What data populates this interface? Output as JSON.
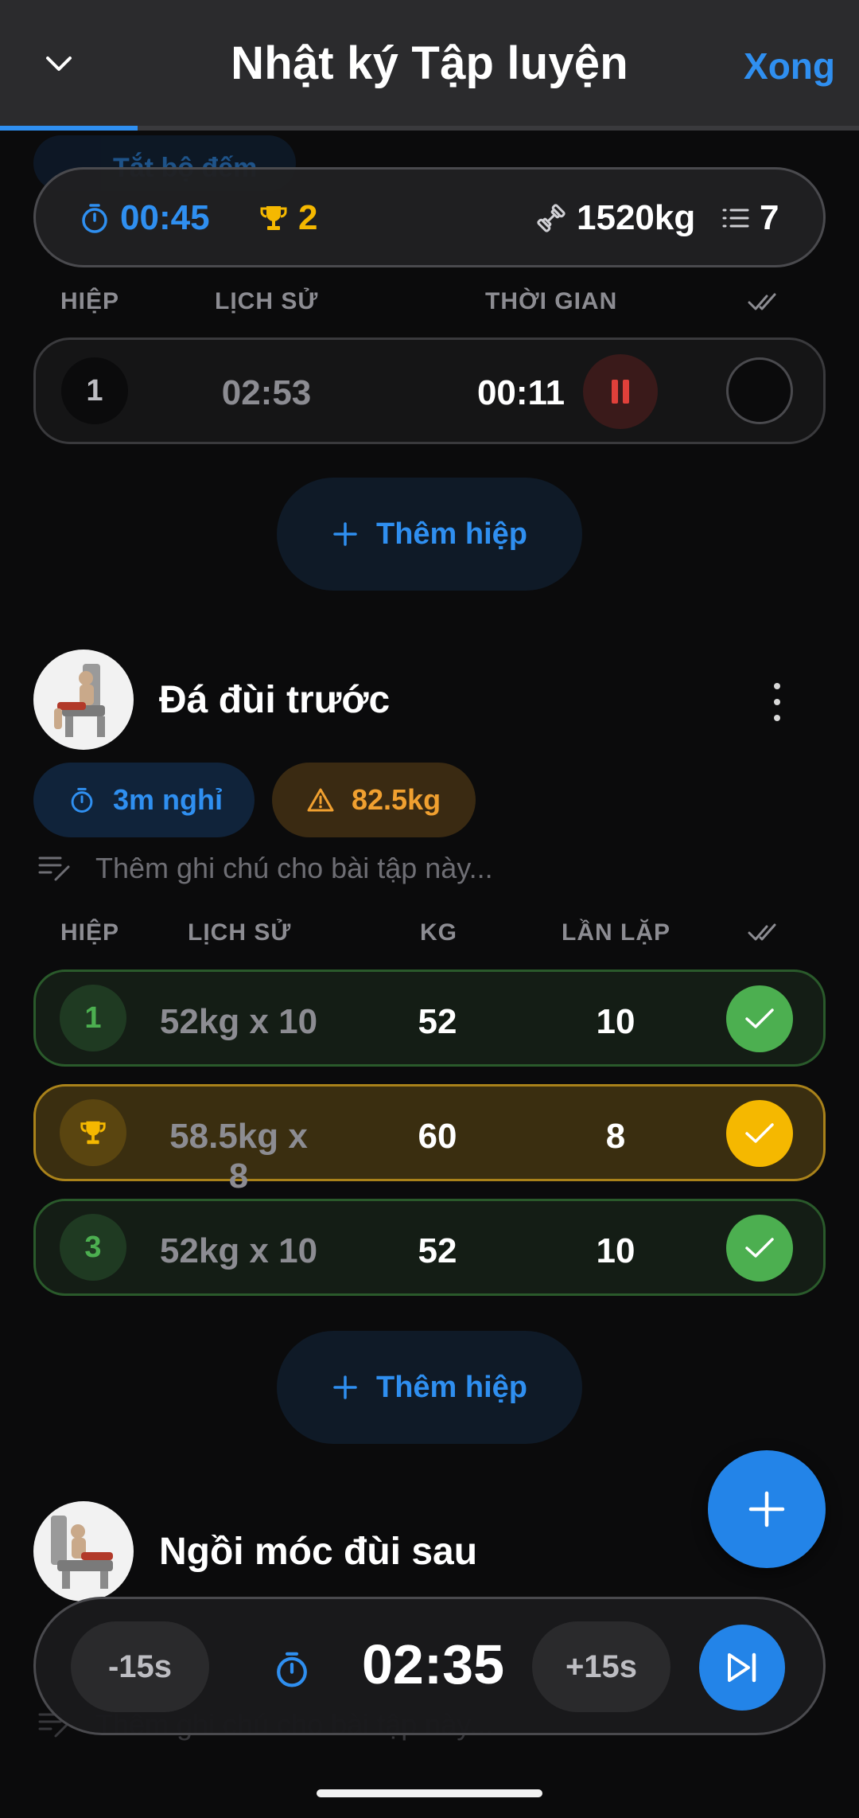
{
  "header": {
    "title": "Nhật ký Tập luyện",
    "done_label": "Xong",
    "progress": 0.16
  },
  "ghost_chip_label": "Tắt bộ đếm",
  "stats": {
    "duration": "00:45",
    "records": "2",
    "volume": "1520kg",
    "sets": "7"
  },
  "timed_exercise": {
    "columns": {
      "set": "HIỆP",
      "history": "LỊCH SỬ",
      "time": "THỜI GIAN"
    },
    "row": {
      "set": "1",
      "history": "02:53",
      "time": "00:11"
    },
    "add_set_label": "Thêm hiệp"
  },
  "exercise_1": {
    "name": "Đá đùi trước",
    "rest_chip": "3m nghỉ",
    "warning_chip": "82.5kg",
    "note_placeholder": "Thêm ghi chú cho bài tập này...",
    "columns": {
      "set": "HIỆP",
      "history": "LỊCH SỬ",
      "kg": "KG",
      "reps": "LẦN LẶP"
    },
    "sets": [
      {
        "set": "1",
        "history": "52kg x 10",
        "kg": "52",
        "reps": "10",
        "type": "done"
      },
      {
        "set": "",
        "history": "58.5kg x 8",
        "kg": "60",
        "reps": "8",
        "type": "record"
      },
      {
        "set": "3",
        "history": "52kg x 10",
        "kg": "52",
        "reps": "10",
        "type": "done"
      }
    ],
    "add_set_label": "Thêm hiệp"
  },
  "exercise_2": {
    "name": "Ngồi móc đùi sau",
    "note_placeholder": "Thêm ghi chú cho bài tập này..."
  },
  "rest_timer": {
    "minus_label": "-15s",
    "plus_label": "+15s",
    "time": "02:35"
  },
  "colors": {
    "accent": "#2f8ff0",
    "gold": "#f5b800",
    "green": "#4caf50",
    "warning": "#f0a030",
    "danger": "#e0403a"
  },
  "icons": {
    "header_left": "chevron-down-icon",
    "duration": "stopwatch-icon",
    "records": "trophy-icon",
    "volume": "dumbbell-icon",
    "sets": "list-icon",
    "pause": "pause-icon",
    "add": "plus-icon",
    "check": "check-icon",
    "note": "note-edit-icon",
    "warning": "warning-icon",
    "skip": "skip-next-icon"
  }
}
